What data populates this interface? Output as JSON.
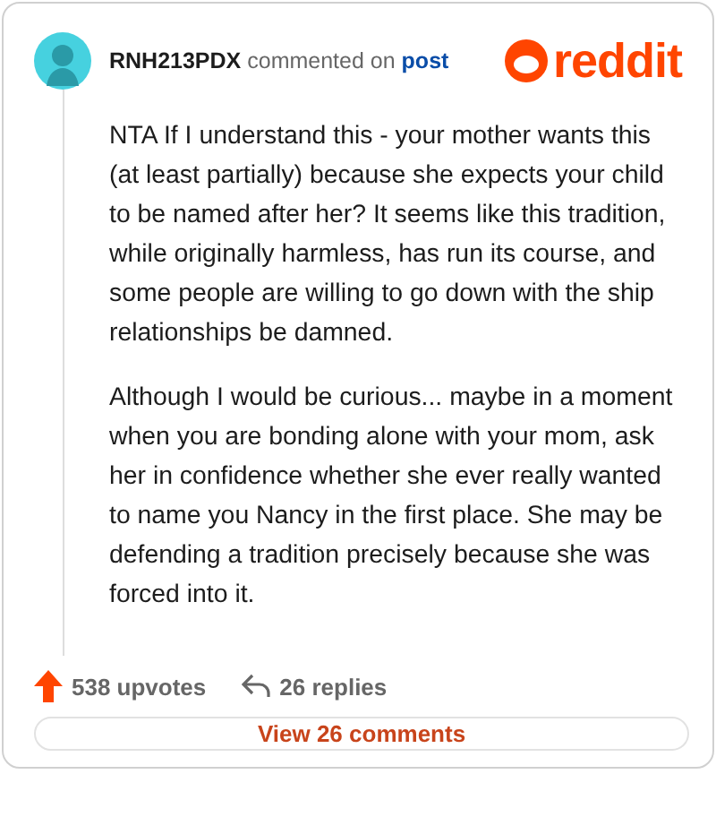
{
  "header": {
    "username": "RNH213PDX",
    "action": "commented on",
    "link": "post",
    "brand": "reddit"
  },
  "paragraphs": [
    "NTA If I understand this - your mother wants this (at least partially) because she expects your child to be named after her? It seems like this tradition, while originally harmless, has run its course, and some people are willing to go down with the ship relationships be damned.",
    "Although I would be curious... maybe in a moment when you are bonding alone with your mom, ask her in confidence whether she ever really wanted to name you Nancy in the first place. She may be defending a tradition precisely because she was forced into it."
  ],
  "stats": {
    "upvotes": "538 upvotes",
    "replies": "26 replies"
  },
  "button": "View 26 comments"
}
